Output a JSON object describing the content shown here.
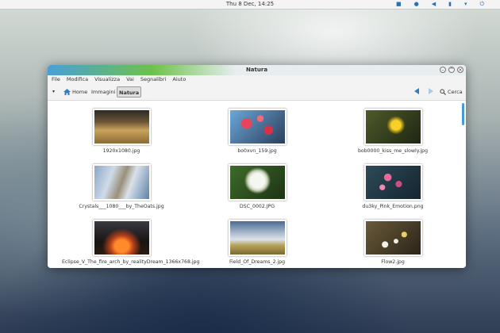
{
  "panel": {
    "clock": "Thu  8 Dec, 14:25",
    "tray_icons": [
      "folder-icon",
      "chat-icon",
      "volume-icon",
      "battery-icon",
      "network-icon",
      "power-icon"
    ]
  },
  "window": {
    "title": "Natura",
    "menu": [
      "File",
      "Modifica",
      "Visualizza",
      "Vai",
      "Segnalibri",
      "Aiuto"
    ],
    "breadcrumbs": [
      "Home",
      "Immagini",
      "Natura"
    ],
    "search_label": "Cerca"
  },
  "files": [
    {
      "name": "1920x1080.jpg",
      "icon": "wheat-field-thumbnail"
    },
    {
      "name": "bo0xvn_159.jpg",
      "icon": "red-blossoms-thumbnail"
    },
    {
      "name": "bob0000_kiss_me_slowly.jpg",
      "icon": "yellow-flower-thumbnail"
    },
    {
      "name": "Crystals___1080___by_TheOats.jpg",
      "icon": "frozen-branch-thumbnail"
    },
    {
      "name": "DSC_0002.JPG",
      "icon": "dandelion-thumbnail"
    },
    {
      "name": "du3ky_Pink_Emotion.png",
      "icon": "pink-blossom-thumbnail"
    },
    {
      "name": "Eclipse_V_The_fire_arch_by_realityDream_1366x768.jpg",
      "icon": "eclipse-thumbnail"
    },
    {
      "name": "Field_Of_Dreams_2.jpg",
      "icon": "sky-field-thumbnail"
    },
    {
      "name": "Flow2.jpg",
      "icon": "white-flowers-thumbnail"
    }
  ]
}
